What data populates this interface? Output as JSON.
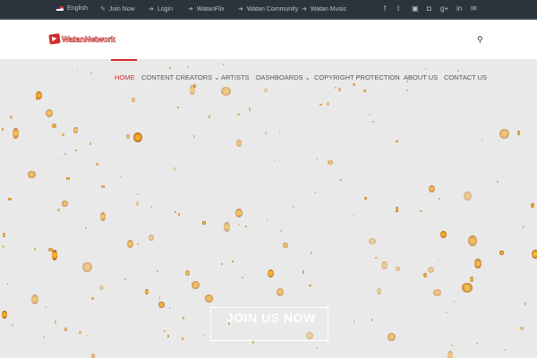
{
  "topbar": {
    "links": [
      {
        "label": "English",
        "icon": "us-flag-icon"
      },
      {
        "label": "Join Now",
        "icon": "edit-icon"
      },
      {
        "label": "Login",
        "icon": "sign-in-icon"
      },
      {
        "label": "WatanFlix",
        "icon": "sign-in-icon"
      },
      {
        "label": "Watan Community",
        "icon": "sign-in-icon"
      },
      {
        "label": "Watan Music",
        "icon": "sign-in-icon"
      }
    ],
    "social": [
      {
        "glyph": "f",
        "icon": "facebook-icon"
      },
      {
        "glyph": "t",
        "icon": "twitter-icon"
      },
      {
        "glyph": "▣",
        "icon": "youtube-icon"
      },
      {
        "glyph": "◘",
        "icon": "instagram-icon"
      },
      {
        "glyph": "g+",
        "icon": "google-plus-icon"
      },
      {
        "glyph": "in",
        "icon": "linkedin-icon"
      },
      {
        "glyph": "✉",
        "icon": "email-icon"
      }
    ]
  },
  "header": {
    "logo": "WatanNetwork",
    "search_icon": "⚲"
  },
  "nav": {
    "items": [
      "HOME",
      "CONTENT CREATORS",
      "ARTISTS",
      "DASHBOARDS",
      "COPYRIGHT PROTECTION",
      "ABOUT US",
      "CONTACT US"
    ],
    "caret": "⌄"
  },
  "hero": {
    "cta": "JOIN US NOW"
  },
  "colors": {
    "accent": "#d42a2a",
    "topbar": "#2b333b"
  }
}
